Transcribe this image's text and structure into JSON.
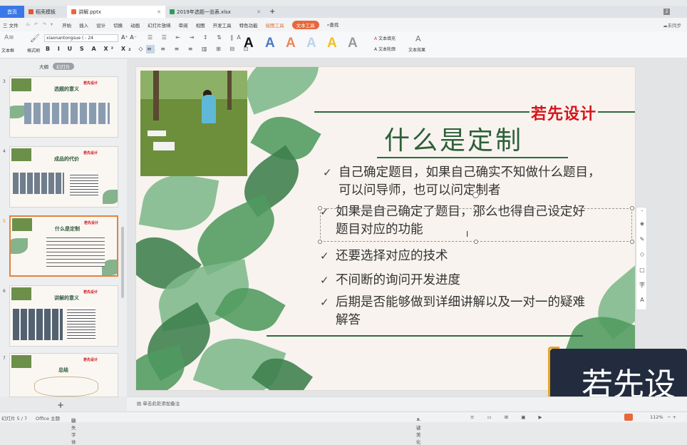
{
  "tabs": [
    {
      "label": "首页"
    },
    {
      "label": "稻壳模板"
    },
    {
      "label": "讲解.pptx"
    },
    {
      "label": "2019年选题一览表.xlsx"
    }
  ],
  "tab_badge": "2",
  "menu": [
    "三 文件",
    "开始",
    "插入",
    "设计",
    "切换",
    "动画",
    "幻灯片放映",
    "审阅",
    "视图",
    "开发工具",
    "特色功能",
    "绘图工具",
    "文本工具",
    "查找"
  ],
  "sync_label": "未同步",
  "ribbon": {
    "textbox": "文本框",
    "brush": "格式刷",
    "font_name": "xiaonantongsue (",
    "font_size": "24",
    "text_fill": "文本填充",
    "text_outline": "文本轮廓",
    "text_effect": "文本效果"
  },
  "left_tabs": {
    "outline": "大纲",
    "slides": "幻灯片"
  },
  "thumbs": [
    {
      "num": "3",
      "title": "选题的意义"
    },
    {
      "num": "4",
      "title": "成品的代价"
    },
    {
      "num": "5",
      "title": "什么是定制"
    },
    {
      "num": "6",
      "title": "讲解的意义"
    },
    {
      "num": "7",
      "title": "总结"
    }
  ],
  "thumb_brand": "若先设计",
  "slide": {
    "brand": "若先设计",
    "title": "什么是定制",
    "bullets": [
      {
        "line1": "自己确定题目，如果自己确实不知做什么题目，",
        "line2": "可以问导师，也可以问定制者"
      },
      {
        "line1": "如果是自己确定了题目，那么也得自己设定好",
        "line2": "题目对应的功能"
      },
      {
        "line1": "还要选择对应的技术",
        "line2": ""
      },
      {
        "line1": "不间断的询问开发进度",
        "line2": ""
      },
      {
        "line1": "后期是否能够做到详细讲解以及一对一的疑难",
        "line2": "解答"
      }
    ]
  },
  "overlay_text": "若先设",
  "notes_placeholder": "单击此处添加备注",
  "status": {
    "slide_count": "幻灯片 5 / 7",
    "theme": "Office 主题",
    "font_missing": "缺失字体",
    "beautify": "一键美化",
    "zoom": "112%"
  }
}
